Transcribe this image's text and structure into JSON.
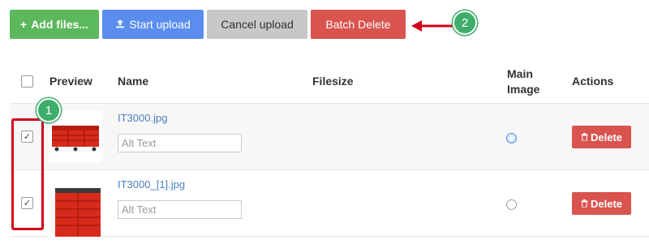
{
  "toolbar": {
    "add_files": "Add files...",
    "start_upload": "Start upload",
    "cancel_upload": "Cancel upload",
    "batch_delete": "Batch Delete"
  },
  "annotations": {
    "badge_1": "1",
    "badge_2": "2"
  },
  "table": {
    "headers": {
      "preview": "Preview",
      "name": "Name",
      "filesize": "Filesize",
      "main_image_line1": "Main",
      "main_image_line2": "Image",
      "actions": "Actions"
    },
    "rows": [
      {
        "filename": "IT3000.jpg",
        "alt_placeholder": "Alt Text",
        "checked": true,
        "main_image": true,
        "delete_label": "Delete"
      },
      {
        "filename": "IT3000_[1].jpg",
        "alt_placeholder": "Alt Text",
        "checked": true,
        "main_image": false,
        "delete_label": "Delete"
      }
    ]
  },
  "colors": {
    "green": "#5cb85c",
    "blue": "#5b8def",
    "gray": "#c8c8c8",
    "red": "#d9534f",
    "highlight": "#d0021b",
    "badge": "#3fae6b"
  }
}
